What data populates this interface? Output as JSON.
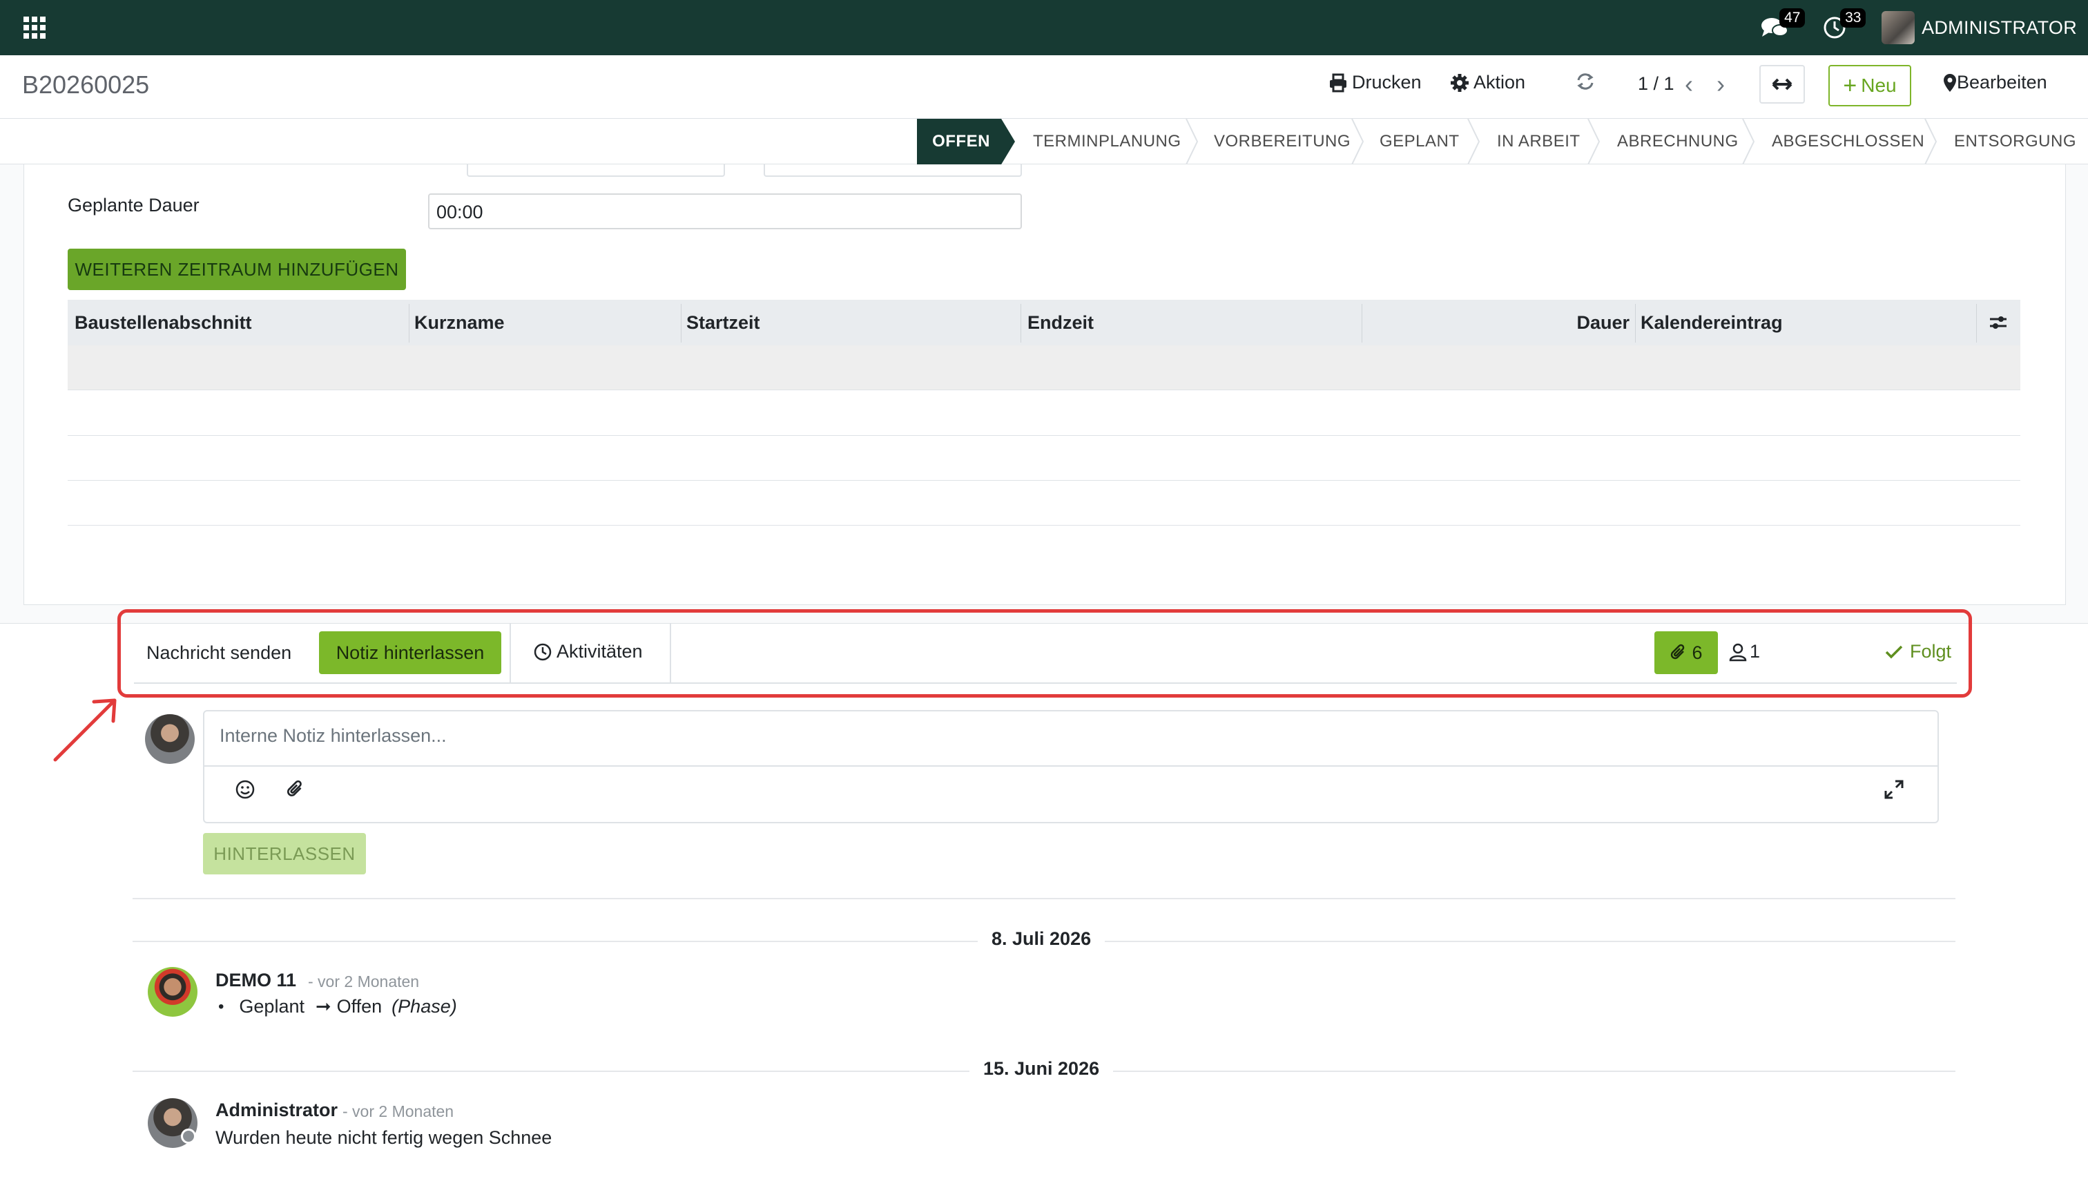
{
  "navbar": {
    "messages_count": "47",
    "activities_count": "33",
    "username": "ADMINISTRATOR"
  },
  "control": {
    "record_name": "B20260025",
    "print_label": "Drucken",
    "action_label": "Aktion",
    "pager": "1 / 1",
    "new_label": "Neu",
    "edit_label": "Bearbeiten"
  },
  "stages": {
    "active": "OFFEN",
    "items": [
      "TERMINPLANUNG",
      "VORBEREITUNG",
      "GEPLANT",
      "IN ARBEIT",
      "ABRECHNUNG",
      "ABGESCHLOSSEN",
      "ENTSORGUNG"
    ]
  },
  "form": {
    "duration_label": "Geplante Dauer",
    "duration_value": "00:00",
    "add_range_label": "WEITEREN ZEITRAUM HINZUFÜGEN"
  },
  "table": {
    "columns": [
      "Baustellenabschnitt",
      "Kurzname",
      "Startzeit",
      "Endzeit",
      "Dauer",
      "Kalendereintrag"
    ],
    "rows": []
  },
  "chatter": {
    "send_message": "Nachricht senden",
    "log_note": "Notiz hinterlassen",
    "activities": "Aktivitäten",
    "attachments_count": "6",
    "followers_count": "1",
    "follow_state": "Folgt",
    "composer_placeholder": "Interne Notiz hinterlassen...",
    "submit_label": "HINTERLASSEN",
    "messages": [
      {
        "date_separator": "8. Juli 2026",
        "author": "DEMO 11",
        "relative_date": "- vor 2 Monaten",
        "tracking_old": "Geplant",
        "tracking_new": "Offen",
        "tracking_field": "(Phase)"
      },
      {
        "date_separator": "15. Juni 2026",
        "author": "Administrator",
        "relative_date": "- vor 2 Monaten",
        "body": "Wurden heute nicht fertig wegen Schnee"
      }
    ]
  },
  "colors": {
    "navbar": "#173a33",
    "primary_green": "#7cb82a",
    "highlight_red": "#e23b3b"
  }
}
